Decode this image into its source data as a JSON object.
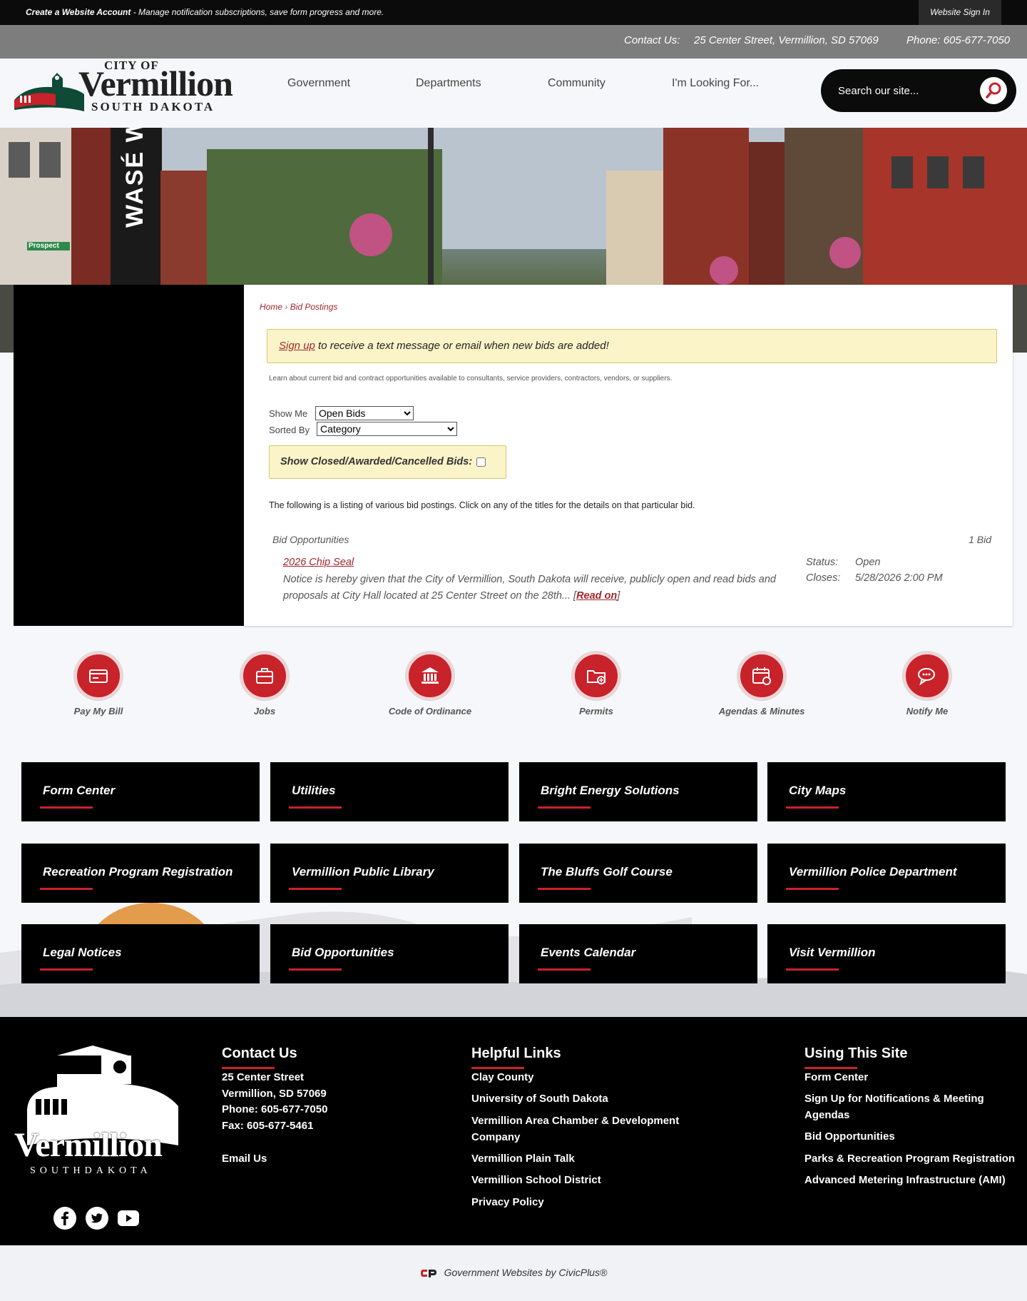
{
  "topbar": {
    "create_account": "Create a Website Account",
    "message": " - Manage notification subscriptions, save form progress and more.",
    "sign_in": "Website Sign In"
  },
  "contact_bar": {
    "label": "Contact Us:",
    "address": "25 Center Street, Vermillion, SD 57069",
    "phone": "Phone: 605-677-7050"
  },
  "header": {
    "logo_text_top": "CITY OF",
    "logo_text_main": "Vermillion",
    "logo_text_sub": "SOUTH DAKOTA",
    "nav": [
      "Government",
      "Departments",
      "Community",
      "I'm Looking For..."
    ],
    "search_placeholder": "Search our site..."
  },
  "banner": {
    "sign_text": "WASÉ WA",
    "street_sign": "Prospect"
  },
  "breadcrumb": [
    "Home",
    "Bid Postings"
  ],
  "alert": {
    "link": "Sign up",
    "text": " to receive a text message or email when new bids are added!"
  },
  "intro": "Learn about current bid and contract opportunities available to consultants, service providers, contractors, vendors, or suppliers.",
  "filters": {
    "show_me_label": "Show Me",
    "show_me_value": "Open Bids",
    "sorted_by_label": "Sorted By",
    "sorted_by_value": "Category",
    "closed_label": "Show Closed/Awarded/Cancelled Bids:"
  },
  "listing_text": "The following is a listing of various bid postings. Click on any of the titles for the details on that particular bid.",
  "bids": {
    "category": "Bid Opportunities",
    "count": "1 Bid",
    "items": [
      {
        "title": "2026 Chip Seal",
        "description": "Notice is hereby given that the City of Vermillion, South Dakota will receive, publicly open and read bids and proposals at City Hall located at 25 Center Street on the 28th... [",
        "read_on": "Read on",
        "description_end": "]",
        "status_label": "Status:",
        "status": "Open",
        "closes_label": "Closes:",
        "closes": "5/28/2026 2:00 PM"
      }
    ]
  },
  "quick_links": [
    {
      "label": "Pay My Bill",
      "icon": "bill-icon"
    },
    {
      "label": "Jobs",
      "icon": "briefcase-icon"
    },
    {
      "label": "Code of Ordinance",
      "icon": "building-icon"
    },
    {
      "label": "Permits",
      "icon": "folder-icon"
    },
    {
      "label": "Agendas & Minutes",
      "icon": "calendar-icon"
    },
    {
      "label": "Notify Me",
      "icon": "chat-icon"
    }
  ],
  "tiles": [
    "Form Center",
    "Utilities",
    "Bright Energy Solutions",
    "City Maps",
    "Recreation Program Registration",
    "Vermillion Public Library",
    "The Bluffs Golf Course",
    "Vermillion Police Department",
    "Legal Notices",
    "Bid Opportunities",
    "Events Calendar",
    "Visit Vermillion"
  ],
  "footer": {
    "logo_main": "Vermillion",
    "logo_sub": "SOUTHDAKOTA",
    "contact": {
      "heading": "Contact Us",
      "lines": [
        "25 Center Street",
        "Vermillion, SD 57069",
        "Phone: 605-677-7050",
        "Fax: 605-677-5461"
      ],
      "email": "Email Us"
    },
    "helpful": {
      "heading": "Helpful Links",
      "links": [
        "Clay County",
        "University of South Dakota",
        "Vermillion Area Chamber & Development Company",
        "Vermillion Plain Talk",
        "Vermillion School District",
        "Privacy Policy"
      ]
    },
    "using": {
      "heading": "Using This Site",
      "links": [
        "Form Center",
        "Sign Up for Notifications & Meeting Agendas",
        "Bid Opportunities",
        "Parks & Recreation Program Registration",
        "Advanced Metering Infrastructure (AMI)"
      ]
    },
    "social": [
      "facebook-icon",
      "twitter-icon",
      "youtube-icon"
    ]
  },
  "credit": "Government Websites by CivicPlus®",
  "colors": {
    "brand_red": "#c8222a",
    "link_red": "#a2262b",
    "notice_yellow": "#fbf4c8"
  }
}
